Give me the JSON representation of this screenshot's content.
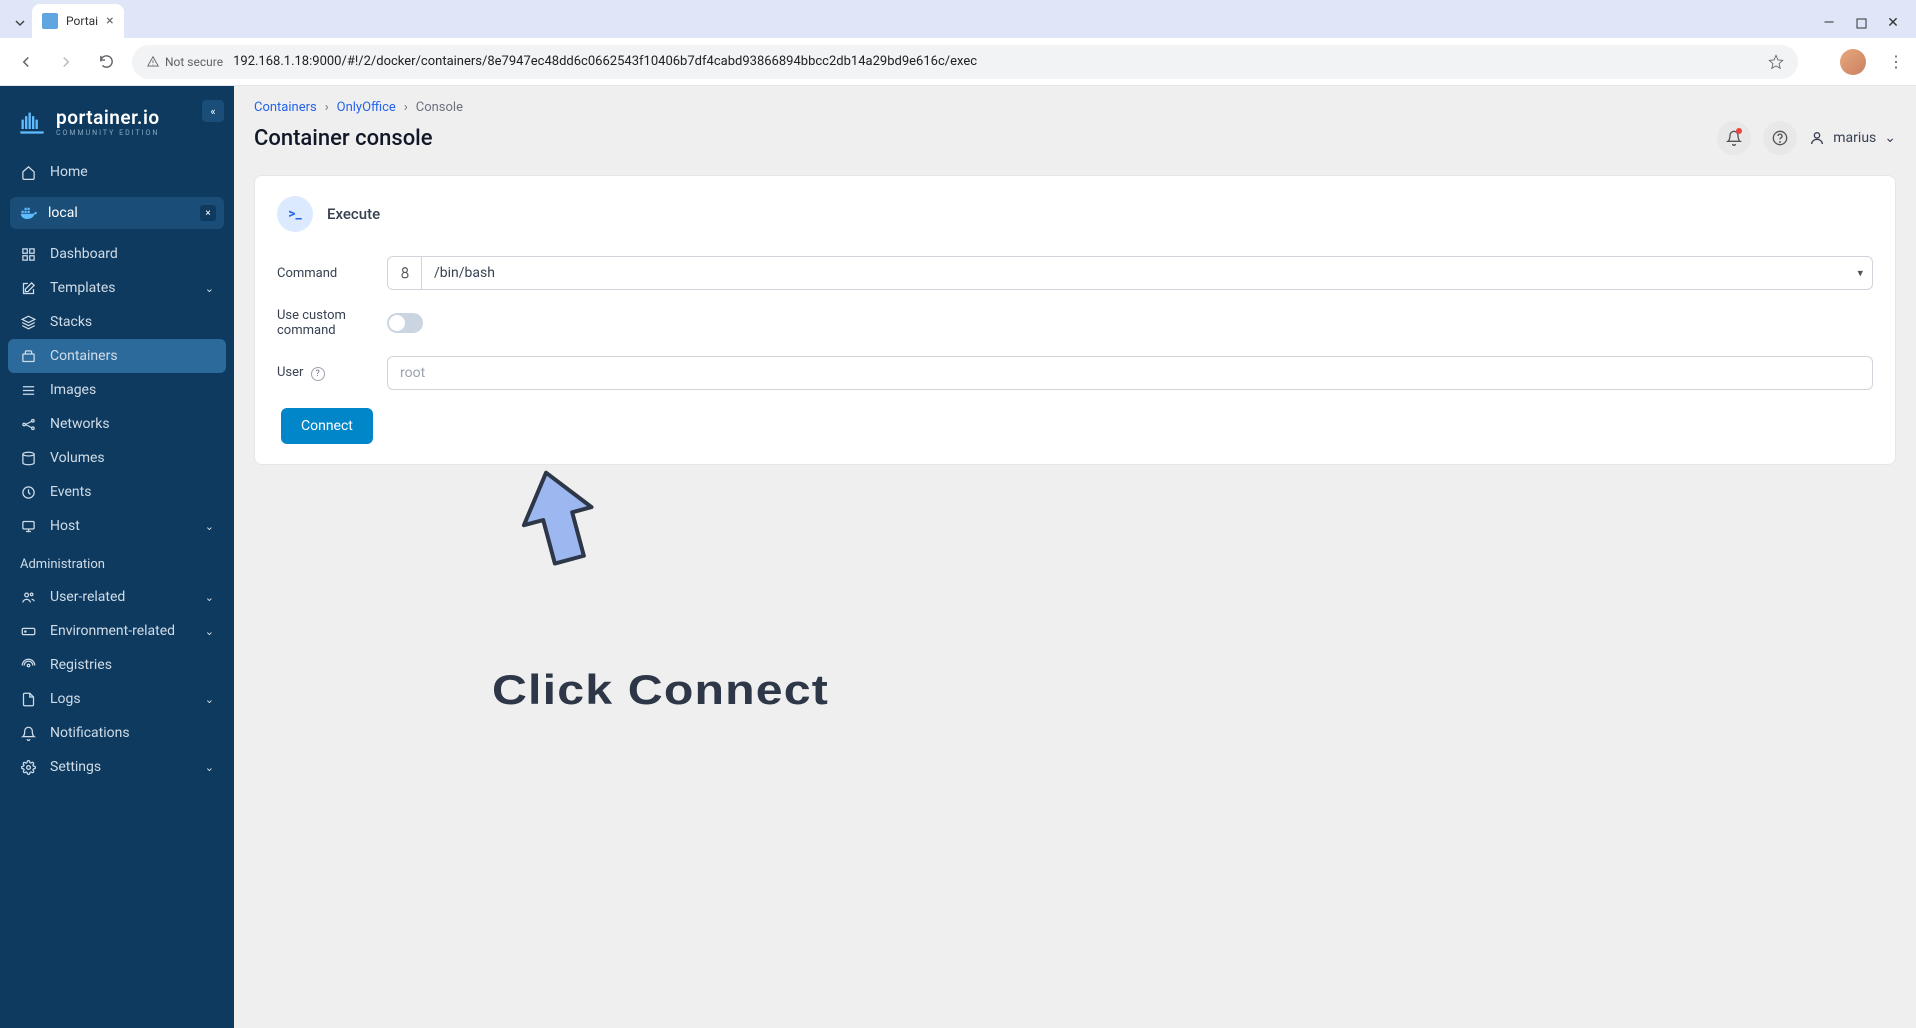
{
  "browser": {
    "tab_title": "Portai",
    "not_secure": "Not secure",
    "url": "192.168.1.18:9000/#!/2/docker/containers/8e7947ec48dd6c0662543f10406b7df4cabd93866894bbcc2db14a29bd9e616c/exec"
  },
  "logo": {
    "name": "portainer.io",
    "sub": "COMMUNITY EDITION"
  },
  "sidebar": {
    "home": "Home",
    "env_name": "local",
    "items": [
      "Dashboard",
      "Templates",
      "Stacks",
      "Containers",
      "Images",
      "Networks",
      "Volumes",
      "Events",
      "Host"
    ],
    "admin_label": "Administration",
    "admin_items": [
      "User-related",
      "Environment-related",
      "Registries",
      "Logs",
      "Notifications",
      "Settings"
    ]
  },
  "breadcrumb": {
    "containers": "Containers",
    "name": "OnlyOffice",
    "current": "Console"
  },
  "page_title": "Container console",
  "user": "marius",
  "card": {
    "title": "Execute",
    "icon_glyph": ">_",
    "labels": {
      "command": "Command",
      "custom": "Use custom command",
      "user": "User"
    },
    "command_value": "/bin/bash",
    "user_placeholder": "root",
    "connect": "Connect"
  },
  "annotation": "Click Connect"
}
